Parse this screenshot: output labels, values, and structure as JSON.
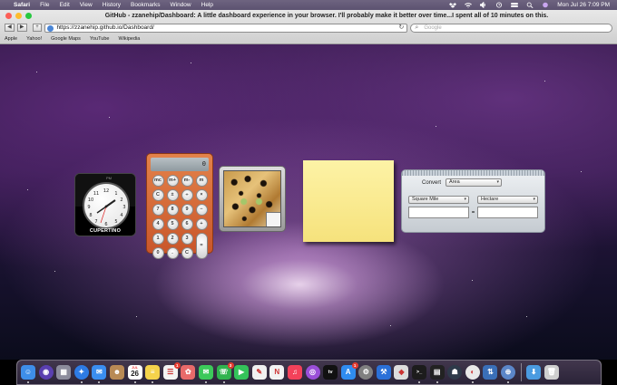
{
  "menubar": {
    "apple": "",
    "items": [
      "Safari",
      "File",
      "Edit",
      "View",
      "History",
      "Bookmarks",
      "Window",
      "Help"
    ],
    "datetime": "Mon Jul 26  7:09 PM"
  },
  "browser": {
    "title": "GitHub - zzanehip/Dashboard: A little dashboard experience in your browser. I'll probably make it better over time...I spent all of 10 minutes on this.",
    "url": "https://zzanehip.github.io/Dashboard/",
    "search_placeholder": "Google",
    "back": "◀",
    "forward": "▶",
    "add": "+",
    "bookmarks": [
      "Apple",
      "Yahoo!",
      "Google Maps",
      "YouTube",
      "Wikipedia"
    ]
  },
  "widgets": {
    "clock": {
      "city": "CUPERTINO",
      "ampm": "PM",
      "numerals": [
        "12",
        "1",
        "2",
        "3",
        "4",
        "5",
        "6",
        "7",
        "8",
        "9",
        "10",
        "11"
      ]
    },
    "calculator": {
      "display": "0",
      "keys": [
        "mc",
        "m+",
        "m-",
        "m",
        "C",
        "±",
        "÷",
        "×",
        "7",
        "8",
        "9",
        "−",
        "4",
        "5",
        "6",
        "+",
        "1",
        "2",
        "3",
        "=",
        "0",
        ".",
        "C"
      ]
    },
    "unit_converter": {
      "convert_label": "Convert",
      "category": "Area",
      "from_unit": "Square Mile",
      "to_unit": "Hectare",
      "equals": "="
    }
  },
  "dock": {
    "apps": [
      {
        "name": "finder",
        "color": "#3e8ee8",
        "glyph": "☺"
      },
      {
        "name": "siri",
        "color": "#5a3fb0",
        "glyph": "◉"
      },
      {
        "name": "launchpad",
        "color": "#8c8c9c",
        "glyph": "▦"
      },
      {
        "name": "safari",
        "color": "#2d7be5",
        "glyph": "✦"
      },
      {
        "name": "mail",
        "color": "#3a8ef0",
        "glyph": "✉"
      },
      {
        "name": "contacts",
        "color": "#b88a55",
        "glyph": "☻"
      },
      {
        "name": "calendar",
        "color": "#ffffff",
        "glyph": ""
      },
      {
        "name": "notes",
        "color": "#f5d34b",
        "glyph": "≡"
      },
      {
        "name": "reminders",
        "color": "#f3f3f3",
        "glyph": "☰"
      },
      {
        "name": "photos",
        "color": "#e86a6a",
        "glyph": "✿"
      },
      {
        "name": "messages",
        "color": "#3cc95a",
        "glyph": "✉"
      },
      {
        "name": "whatsapp",
        "color": "#30b34e",
        "glyph": "☏"
      },
      {
        "name": "facetime",
        "color": "#34c35a",
        "glyph": "▶"
      },
      {
        "name": "pages",
        "color": "#f0f0f0",
        "glyph": "✎"
      },
      {
        "name": "news",
        "color": "#f2f2f2",
        "glyph": "N"
      },
      {
        "name": "music",
        "color": "#f3415a",
        "glyph": "♫"
      },
      {
        "name": "podcasts",
        "color": "#9a4fd8",
        "glyph": "◎"
      },
      {
        "name": "tv",
        "color": "#111111",
        "glyph": "tv"
      },
      {
        "name": "app-store",
        "color": "#2f8cf0",
        "glyph": "A"
      },
      {
        "name": "system-preferences",
        "color": "#808080",
        "glyph": "⚙"
      },
      {
        "name": "xcode",
        "color": "#2a70d8",
        "glyph": "⚒"
      },
      {
        "name": "script-editor",
        "color": "#dddddd",
        "glyph": "◆"
      },
      {
        "name": "terminal",
        "color": "#1c1c1c",
        "glyph": ">_"
      },
      {
        "name": "activity-monitor",
        "color": "#222222",
        "glyph": "▤"
      },
      {
        "name": "alien-app",
        "color": "#2e3a4a",
        "glyph": "☗"
      },
      {
        "name": "chrome",
        "color": "#e9e9e9",
        "glyph": "◐"
      },
      {
        "name": "git-app",
        "color": "#3a6fb8",
        "glyph": "⇅"
      },
      {
        "name": "compass-app",
        "color": "#5b86c8",
        "glyph": "⊕"
      },
      {
        "name": "downloads-folder",
        "color": "#4a9be0",
        "glyph": "⬇"
      },
      {
        "name": "trash",
        "color": "#cfcfcf",
        "glyph": "🗑"
      }
    ],
    "calendar": {
      "month": "JUL",
      "day": "26"
    },
    "badges": {
      "mail": "",
      "reminders": "1",
      "messages": "",
      "whatsapp": "3",
      "facetime": "",
      "app-store": "1"
    }
  }
}
